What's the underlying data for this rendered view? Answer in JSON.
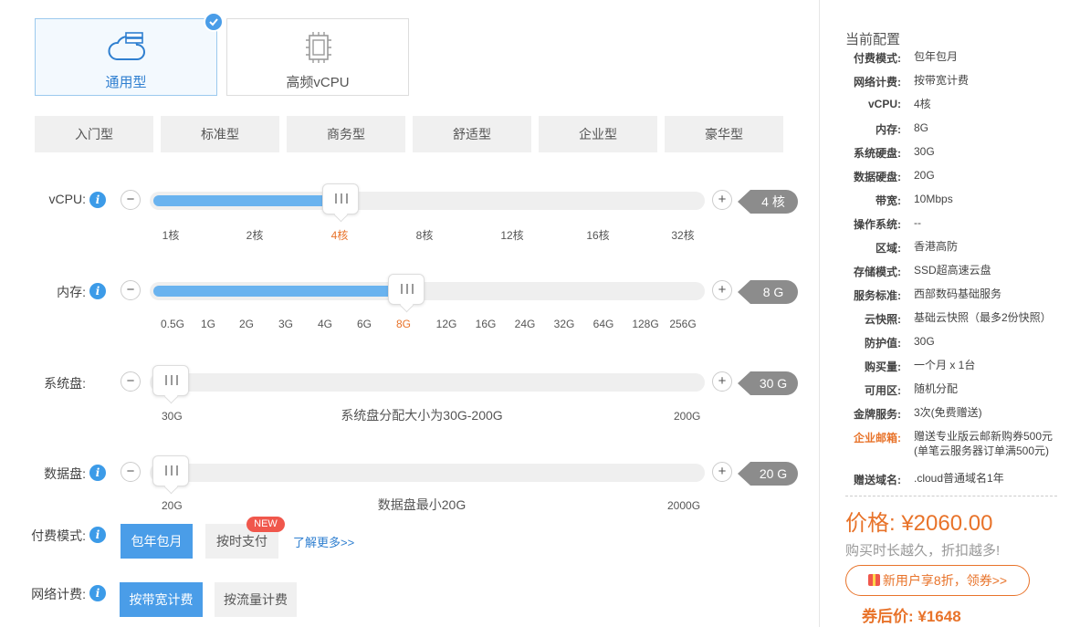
{
  "server_types": [
    {
      "label": "通用型",
      "icon": "cloud-server-icon",
      "selected": true
    },
    {
      "label": "高频vCPU",
      "icon": "cpu-chip-icon",
      "selected": false
    }
  ],
  "plans": [
    "入门型",
    "标准型",
    "商务型",
    "舒适型",
    "企业型",
    "豪华型"
  ],
  "sliders": {
    "vcpu": {
      "label": "vCPU:",
      "value": "4 核",
      "ticks": [
        "1核",
        "2核",
        "4核",
        "8核",
        "12核",
        "16核",
        "32核"
      ],
      "selected_index": 2,
      "fill_fraction": 0.34
    },
    "memory": {
      "label": "内存:",
      "value": "8 G",
      "ticks": [
        "0.5G",
        "1G",
        "2G",
        "3G",
        "4G",
        "6G",
        "8G",
        "12G",
        "16G",
        "24G",
        "32G",
        "64G",
        "128G",
        "256G"
      ],
      "selected_index": 6,
      "fill_fraction": 0.46
    },
    "system_disk": {
      "label": "系统盘:",
      "value": "30 G",
      "min": "30G",
      "max": "200G",
      "hint": "系统盘分配大小为30G-200G",
      "fill_fraction": 0.0
    },
    "data_disk": {
      "label": "数据盘:",
      "value": "20 G",
      "min": "20G",
      "max": "2000G",
      "hint": "数据盘最小20G",
      "fill_fraction": 0.0
    }
  },
  "billing": {
    "label": "付费模式:",
    "options": [
      "包年包月",
      "按时支付"
    ],
    "selected_index": 0,
    "new_badge": "NEW",
    "learn_more": "了解更多>>"
  },
  "network": {
    "label": "网络计费:",
    "options": [
      "按带宽计费",
      "按流量计费"
    ],
    "selected_index": 0
  },
  "summary": {
    "title": "当前配置",
    "rows": [
      {
        "key": "付费模式:",
        "value": "包年包月"
      },
      {
        "key": "网络计费:",
        "value": "按带宽计费"
      },
      {
        "key": "vCPU:",
        "value": "4核"
      },
      {
        "key": "内存:",
        "value": "8G"
      },
      {
        "key": "系统硬盘:",
        "value": "30G"
      },
      {
        "key": "数据硬盘:",
        "value": "20G"
      },
      {
        "key": "带宽:",
        "value": "10Mbps"
      },
      {
        "key": "操作系统:",
        "value": "--"
      },
      {
        "key": "区域:",
        "value": "香港高防"
      },
      {
        "key": "存储模式:",
        "value": "SSD超高速云盘"
      },
      {
        "key": "服务标准:",
        "value": "西部数码基础服务"
      },
      {
        "key": "云快照:",
        "value": "基础云快照（最多2份快照）"
      },
      {
        "key": "防护值:",
        "value": "30G"
      },
      {
        "key": "购买量:",
        "value": "一个月 x 1台"
      },
      {
        "key": "可用区:",
        "value": "随机分配"
      },
      {
        "key": "金牌服务:",
        "value": "3次(免费赠送)"
      },
      {
        "key": "企业邮箱:",
        "value": "赠送专业版云邮新购券500元",
        "value2": "(单笔云服务器订单满500元)",
        "highlight": true
      },
      {
        "key": "赠送域名:",
        "value": ".cloud普通域名1年"
      }
    ],
    "price": "价格: ¥2060.00",
    "slogan": "购买时长越久，折扣越多!",
    "coupon": "新用户享8折，领券>>",
    "after_coupon": "券后价: ¥1648"
  },
  "colors": {
    "accent": "#4a9de8",
    "orange": "#e8732a",
    "fill": "#6ab3ef",
    "badge": "#f0574c"
  }
}
